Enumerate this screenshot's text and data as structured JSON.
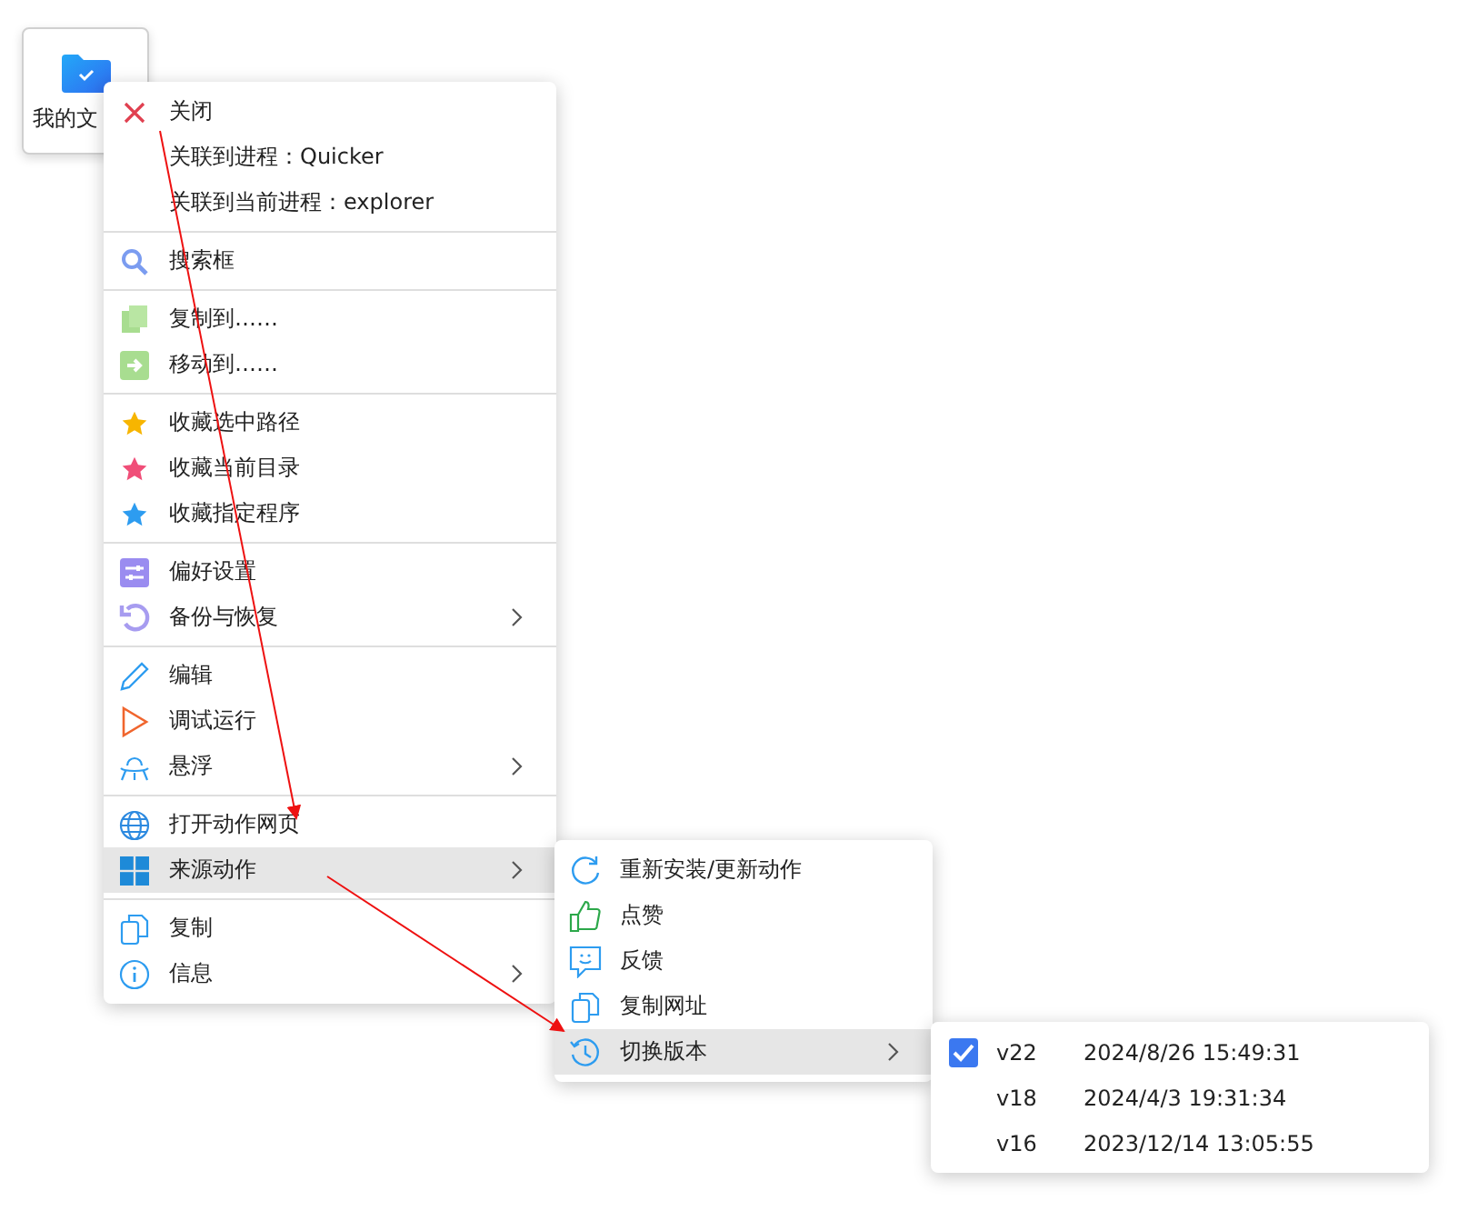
{
  "desktop_icon": {
    "label": "我的文"
  },
  "menu": {
    "sections": [
      [
        {
          "kind": "close",
          "label": "关闭",
          "submenu": false,
          "selected": false
        },
        {
          "label": "关联到进程：Quicker",
          "submenu": false,
          "selected": false
        },
        {
          "label": "关联到当前进程：explorer",
          "submenu": false,
          "selected": false
        }
      ],
      [
        {
          "kind": "search",
          "label": "搜索框",
          "submenu": false,
          "selected": false
        }
      ],
      [
        {
          "kind": "copy-green",
          "label": "复制到……",
          "submenu": false,
          "selected": false
        },
        {
          "kind": "move",
          "label": "移动到……",
          "submenu": false,
          "selected": false
        }
      ],
      [
        {
          "kind": "star-yellow",
          "label": "收藏选中路径",
          "submenu": false,
          "selected": false
        },
        {
          "kind": "star-pink",
          "label": "收藏当前目录",
          "submenu": false,
          "selected": false
        },
        {
          "kind": "star-blue",
          "label": "收藏指定程序",
          "submenu": false,
          "selected": false
        }
      ],
      [
        {
          "kind": "sliders",
          "label": "偏好设置",
          "submenu": false,
          "selected": false
        },
        {
          "kind": "undo",
          "label": "备份与恢复",
          "submenu": true,
          "selected": false
        }
      ],
      [
        {
          "kind": "pencil",
          "label": "编辑",
          "submenu": false,
          "selected": false
        },
        {
          "kind": "play",
          "label": "调试运行",
          "submenu": false,
          "selected": false
        },
        {
          "kind": "ufo",
          "label": "悬浮",
          "submenu": true,
          "selected": false
        }
      ],
      [
        {
          "kind": "globe",
          "label": "打开动作网页",
          "submenu": false,
          "selected": false
        },
        {
          "kind": "windows",
          "label": "来源动作",
          "submenu": true,
          "selected": true
        }
      ],
      [
        {
          "kind": "copy",
          "label": "复制",
          "submenu": false,
          "selected": false
        },
        {
          "kind": "info",
          "label": "信息",
          "submenu": true,
          "selected": false
        }
      ]
    ]
  },
  "submenu": {
    "items": [
      {
        "kind": "refresh",
        "label": "重新安装/更新动作",
        "submenu": false,
        "selected": false
      },
      {
        "kind": "thumb",
        "label": "点赞",
        "submenu": false,
        "selected": false
      },
      {
        "kind": "chat",
        "label": "反馈",
        "submenu": false,
        "selected": false
      },
      {
        "kind": "copy",
        "label": "复制网址",
        "submenu": false,
        "selected": false
      },
      {
        "kind": "history",
        "label": "切换版本",
        "submenu": true,
        "selected": true
      }
    ]
  },
  "versions": [
    {
      "version": "v22",
      "date": "2024/8/26 15:49:31",
      "checked": true
    },
    {
      "version": "v18",
      "date": "2024/4/3 19:31:34",
      "checked": false
    },
    {
      "version": "v16",
      "date": "2023/12/14 13:05:55",
      "checked": false
    }
  ]
}
